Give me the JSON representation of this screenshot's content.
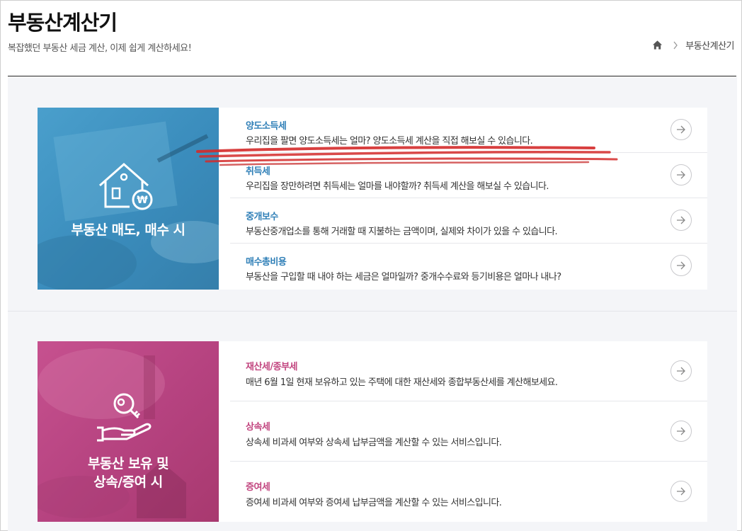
{
  "header": {
    "title": "부동산계산기",
    "subtitle": "복잡했던 부동산 세금 계산, 이제 쉽게 계산하세요!",
    "breadcrumb": {
      "home_icon": "home-icon",
      "current": "부동산계산기"
    }
  },
  "sections": [
    {
      "banner_label": "부동산 매도, 매수 시",
      "banner_icon": "house-won-icon",
      "accent": "#2f7fb7",
      "items": [
        {
          "title": "양도소득세",
          "desc": "우리집을 팔면 양도소득세는 얼마? 양도소득세 계산을 직접 해보실 수 있습니다."
        },
        {
          "title": "취득세",
          "desc": "우리집을 장만하려면 취득세는 얼마를 내야할까? 취득세 계산을 해보실 수 있습니다."
        },
        {
          "title": "중개보수",
          "desc": "부동산중개업소를 통해 거래할 때 지불하는 금액이며, 실제와 차이가 있을 수 있습니다."
        },
        {
          "title": "매수총비용",
          "desc": "부동산을 구입할 때 내야 하는 세금은 얼마일까? 중개수수료와 등기비용은 얼마나 내나?"
        }
      ]
    },
    {
      "banner_label_line1": "부동산 보유 및",
      "banner_label_line2": "상속/증여 시",
      "banner_icon": "key-hand-icon",
      "accent": "#c2457f",
      "items": [
        {
          "title": "재산세/종부세",
          "desc": "매년 6월 1일 현재 보유하고 있는 주택에 대한 재산세와 종합부동산세를 계산해보세요."
        },
        {
          "title": "상속세",
          "desc": "상속세 비과세 여부와 상속세 납부금액을 계산할 수 있는 서비스입니다."
        },
        {
          "title": "증여세",
          "desc": "증여세 비과세 여부와 증여세 납부금액을 계산할 수 있는 서비스입니다."
        }
      ]
    }
  ],
  "icons": {
    "arrow": "arrow-right-circle-icon"
  },
  "annotation_color": "#d42a2a"
}
